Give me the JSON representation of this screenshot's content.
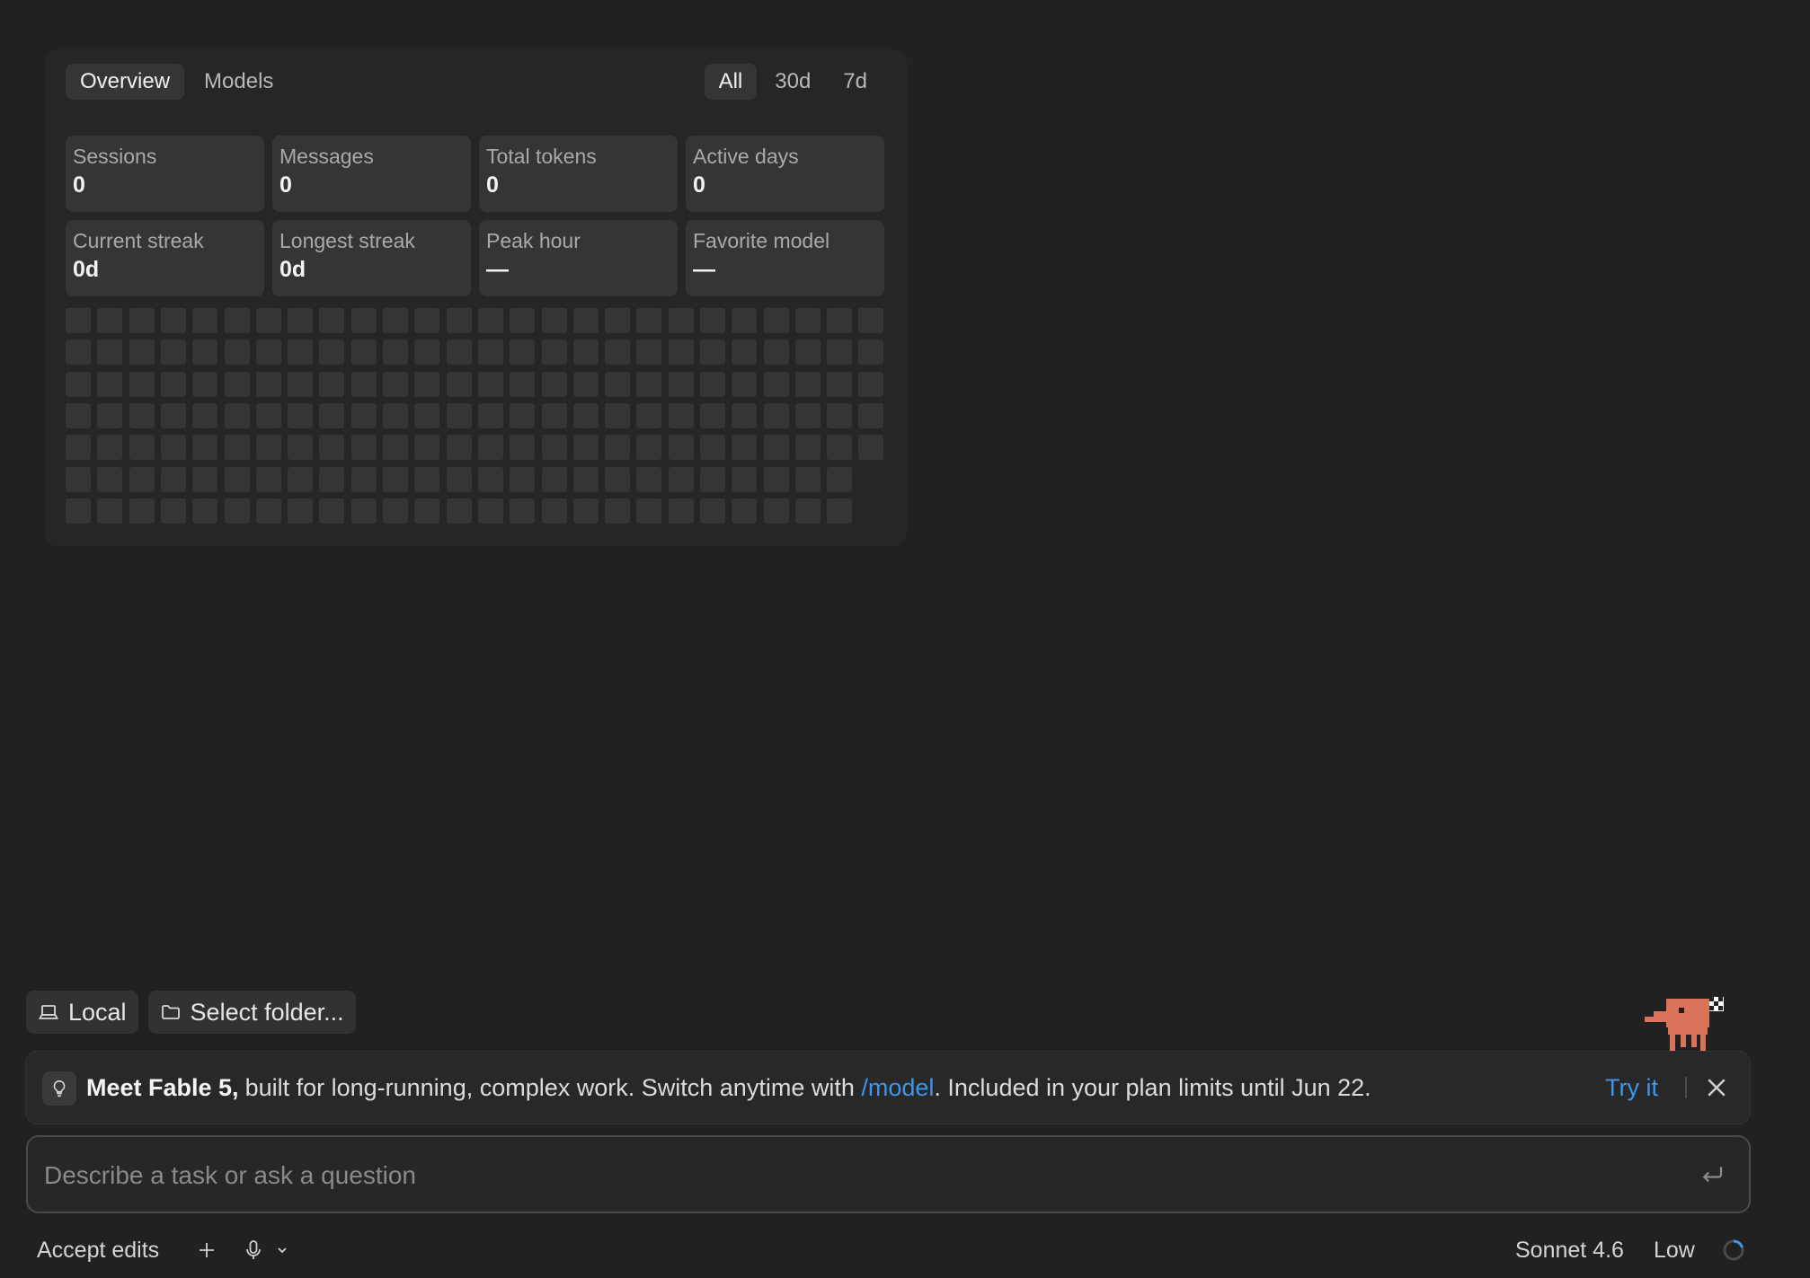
{
  "stats_panel": {
    "tabs": [
      {
        "label": "Overview",
        "active": true
      },
      {
        "label": "Models",
        "active": false
      }
    ],
    "ranges": [
      {
        "label": "All",
        "active": true
      },
      {
        "label": "30d",
        "active": false
      },
      {
        "label": "7d",
        "active": false
      }
    ],
    "stats": [
      {
        "label": "Sessions",
        "value": "0"
      },
      {
        "label": "Messages",
        "value": "0"
      },
      {
        "label": "Total tokens",
        "value": "0"
      },
      {
        "label": "Active days",
        "value": "0"
      },
      {
        "label": "Current streak",
        "value": "0d"
      },
      {
        "label": "Longest streak",
        "value": "0d"
      },
      {
        "label": "Peak hour",
        "value": "—"
      },
      {
        "label": "Favorite model",
        "value": "—"
      }
    ],
    "heatmap": {
      "rows": 7,
      "full_rows": 5,
      "cols": 26,
      "cols_short_rows": 25,
      "cell_color": "#353535"
    }
  },
  "chips": {
    "environment": {
      "label": "Local",
      "icon": "laptop-icon"
    },
    "folder": {
      "label": "Select folder...",
      "icon": "folder-icon"
    }
  },
  "banner": {
    "icon": "lightbulb-icon",
    "bold": "Meet Fable 5,",
    "text_before_link": "built for long-running, complex work. Switch anytime with ",
    "link": "/model",
    "text_after_link": ". Included in your plan limits until Jun 22.",
    "action": "Try it",
    "close_icon": "close-icon",
    "link_color": "#3d97ea"
  },
  "composer": {
    "placeholder": "Describe a task or ask a question",
    "value": "",
    "submit_icon": "enter-icon"
  },
  "bottom_bar": {
    "mode": "Accept edits",
    "model": "Sonnet 4.6",
    "effort": "Low"
  },
  "colors": {
    "background": "#212121",
    "panel": "#262626",
    "card": "#353535",
    "accent": "#3d97ea",
    "mascot": "#d9745a"
  }
}
